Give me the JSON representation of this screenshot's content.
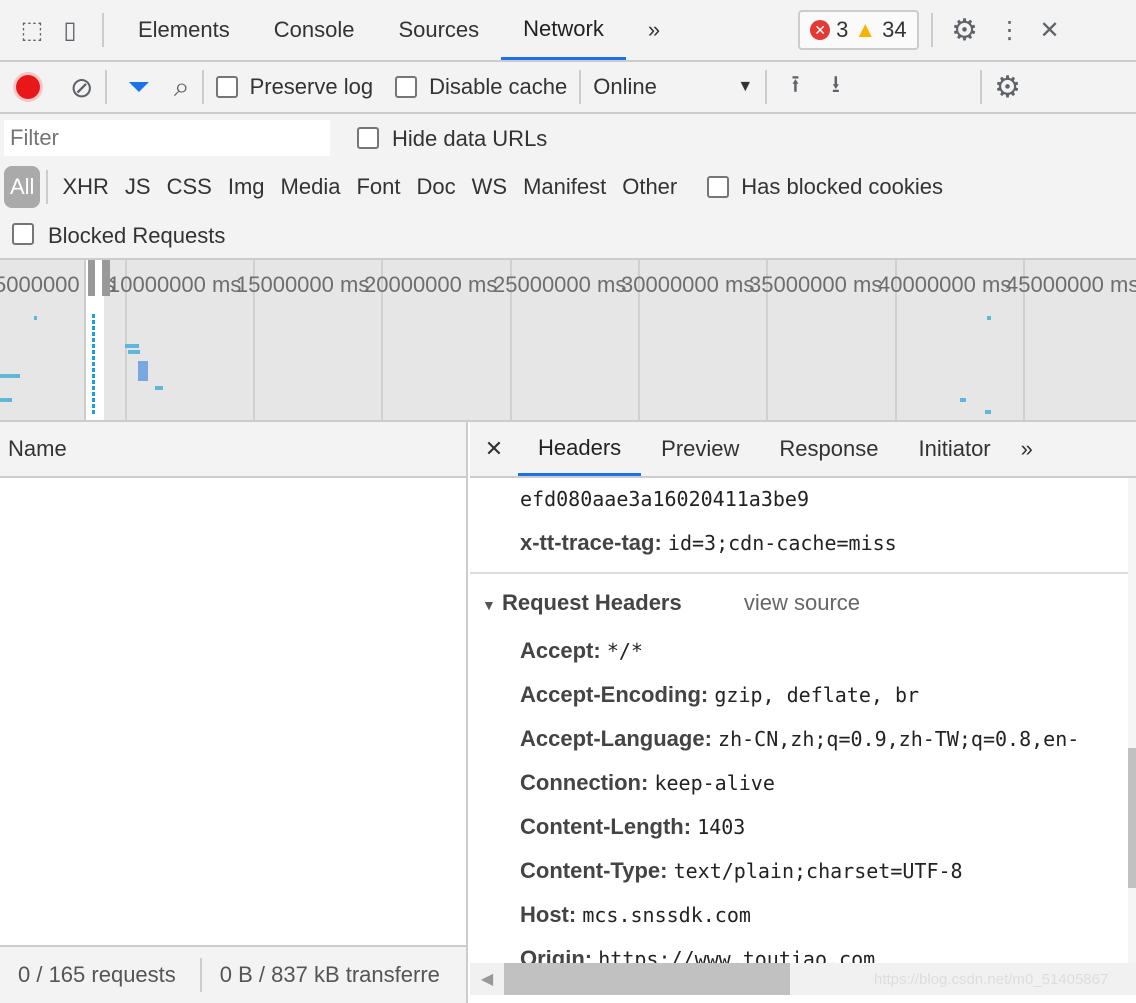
{
  "devtools": {
    "tabs": [
      "Elements",
      "Console",
      "Sources",
      "Network"
    ],
    "active_tab": "Network",
    "more": "»",
    "errors": "3",
    "warnings": "34"
  },
  "toolbar": {
    "preserve_log": "Preserve log",
    "disable_cache": "Disable cache",
    "throttle": "Online"
  },
  "filter": {
    "placeholder": "Filter",
    "hide_data_urls": "Hide data URLs",
    "types": [
      "All",
      "XHR",
      "JS",
      "CSS",
      "Img",
      "Media",
      "Font",
      "Doc",
      "WS",
      "Manifest",
      "Other"
    ],
    "has_blocked_cookies": "Has blocked cookies",
    "blocked_requests": "Blocked Requests"
  },
  "overview": {
    "ticks": [
      "5000000 ms",
      "10000000 ms",
      "15000000 ms",
      "20000000 ms",
      "25000000 ms",
      "30000000 ms",
      "35000000 ms",
      "40000000 ms",
      "45000000 ms"
    ]
  },
  "list": {
    "name_header": "Name",
    "status_requests": "0 / 165 requests",
    "status_transferred": "0 B / 837 kB transferre"
  },
  "detail": {
    "tabs": [
      "Headers",
      "Preview",
      "Response",
      "Initiator"
    ],
    "active_tab": "Headers",
    "more": "»",
    "response_tail": [
      {
        "key": "",
        "value": "efd080aae3a16020411a3be9"
      },
      {
        "key": "x-tt-trace-tag:",
        "value": "id=3;cdn-cache=miss"
      }
    ],
    "section_title": "Request Headers",
    "view_source": "view source",
    "request_headers": [
      {
        "key": "Accept:",
        "value": "*/*"
      },
      {
        "key": "Accept-Encoding:",
        "value": "gzip, deflate, br"
      },
      {
        "key": "Accept-Language:",
        "value": "zh-CN,zh;q=0.9,zh-TW;q=0.8,en-"
      },
      {
        "key": "Connection:",
        "value": "keep-alive"
      },
      {
        "key": "Content-Length:",
        "value": "1403"
      },
      {
        "key": "Content-Type:",
        "value": "text/plain;charset=UTF-8"
      },
      {
        "key": "Host:",
        "value": "mcs.snssdk.com"
      },
      {
        "key": "Origin:",
        "value": "https://www.toutiao.com"
      }
    ]
  },
  "watermark": "https://blog.csdn.net/m0_51405867"
}
